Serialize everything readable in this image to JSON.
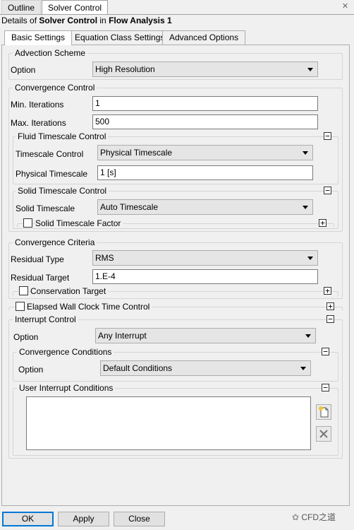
{
  "top_tabs": [
    "Outline",
    "Solver Control"
  ],
  "details": {
    "prefix": "Details of ",
    "object": "Solver Control",
    "middle": " in ",
    "parent": "Flow Analysis 1"
  },
  "sub_tabs": [
    "Basic Settings",
    "Equation Class Settings",
    "Advanced Options"
  ],
  "advection": {
    "title": "Advection Scheme",
    "option_label": "Option",
    "option_value": "High Resolution"
  },
  "convergence_control": {
    "title": "Convergence Control",
    "min_label": "Min. Iterations",
    "min_value": "1",
    "max_label": "Max. Iterations",
    "max_value": "500",
    "fluid": {
      "title": "Fluid Timescale Control",
      "control_label": "Timescale Control",
      "control_value": "Physical Timescale",
      "phys_label": "Physical Timescale",
      "phys_value": "1 [s]"
    },
    "solid": {
      "title": "Solid Timescale Control",
      "ts_label": "Solid Timescale",
      "ts_value": "Auto Timescale",
      "factor_label": "Solid Timescale Factor"
    }
  },
  "criteria": {
    "title": "Convergence Criteria",
    "type_label": "Residual Type",
    "type_value": "RMS",
    "target_label": "Residual Target",
    "target_value": "1.E-4",
    "conservation_label": "Conservation Target"
  },
  "elapsed_label": "Elapsed Wall Clock Time Control",
  "interrupt": {
    "title": "Interrupt Control",
    "option_label": "Option",
    "option_value": "Any Interrupt",
    "conditions": {
      "title": "Convergence Conditions",
      "option_label": "Option",
      "option_value": "Default Conditions"
    },
    "user_title": "User Interrupt Conditions"
  },
  "buttons": {
    "ok": "OK",
    "apply": "Apply",
    "close": "Close"
  },
  "watermark": "CFD之道",
  "colors": {
    "default_button_border": "#0078d7",
    "panel_bg": "#f0f0f0"
  }
}
